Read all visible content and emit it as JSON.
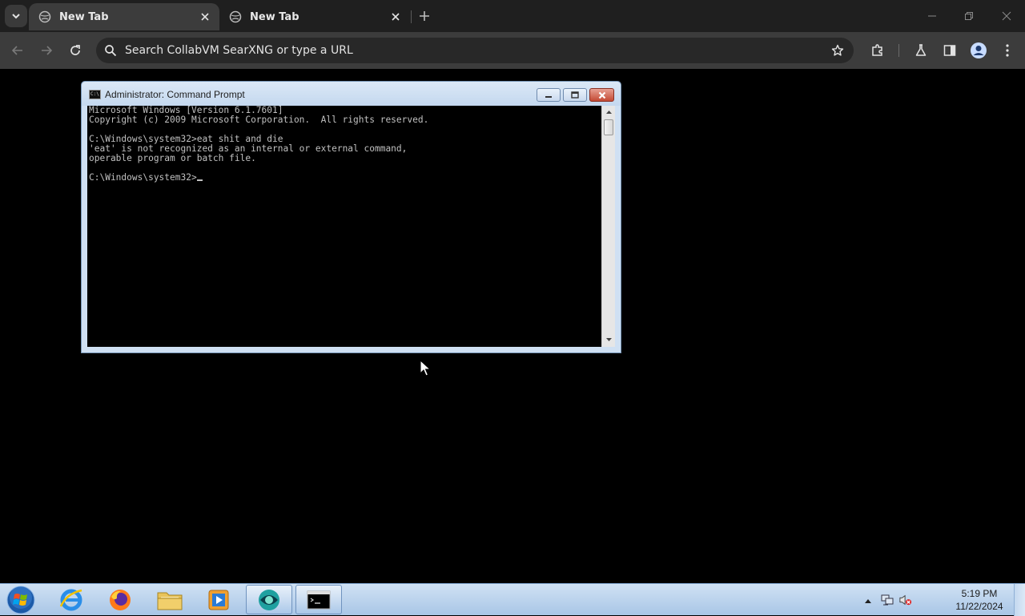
{
  "browser": {
    "tabs": [
      {
        "title": "New Tab",
        "active": true
      },
      {
        "title": "New Tab",
        "active": false
      }
    ],
    "omnibox": {
      "placeholder": "Search CollabVM SearXNG or type a URL",
      "value": ""
    }
  },
  "cmd_window": {
    "title": "Administrator:  Command Prompt",
    "lines": [
      "Microsoft Windows [Version 6.1.7601]",
      "Copyright (c) 2009 Microsoft Corporation.  All rights reserved.",
      "",
      "C:\\Windows\\system32>eat shit and die",
      "'eat' is not recognized as an internal or external command,",
      "operable program or batch file.",
      "",
      "C:\\Windows\\system32>"
    ]
  },
  "taskbar": {
    "apps": [
      {
        "name": "internet-explorer",
        "running": false
      },
      {
        "name": "firefox",
        "running": false
      },
      {
        "name": "file-explorer",
        "running": false
      },
      {
        "name": "media-player",
        "running": false
      },
      {
        "name": "browser-app",
        "running": true
      },
      {
        "name": "command-prompt",
        "running": true
      }
    ],
    "clock": {
      "time": "5:19 PM",
      "date": "11/22/2024"
    }
  },
  "colors": {
    "chrome_dark": "#1f1f1f",
    "toolbar": "#3c3c3c",
    "console_text": "#c0c0c0",
    "taskbar": "#a9c6e6"
  }
}
